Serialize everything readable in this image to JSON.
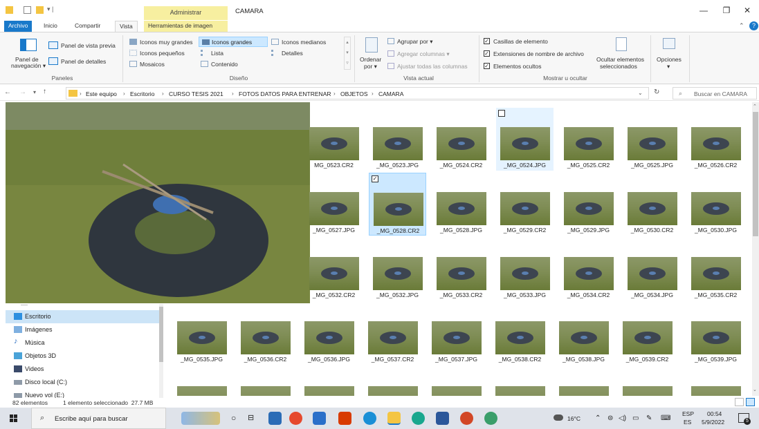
{
  "titlebar": {
    "context_tab_group": "Administrar",
    "window_title": "CAMARA",
    "minimize": "—",
    "maximize": "❐",
    "close": "✕"
  },
  "ribbon_tabs": {
    "file": "Archivo",
    "home": "Inicio",
    "share": "Compartir",
    "view": "Vista",
    "image_tools": "Herramientas de imagen"
  },
  "ribbon": {
    "panes": {
      "nav_pane": "Panel de",
      "nav_pane2": "navegación ▾",
      "preview_pane": "Panel de vista previa",
      "details_pane": "Panel de detalles",
      "group": "Paneles"
    },
    "layout": {
      "extra_large": "Iconos muy grandes",
      "large": "Iconos grandes",
      "medium": "Iconos medianos",
      "small": "Iconos pequeños",
      "list": "Lista",
      "details": "Detalles",
      "tiles": "Mosaicos",
      "content": "Contenido",
      "group": "Diseño"
    },
    "current_view": {
      "sort_by": "Ordenar",
      "sort_by2": "por ▾",
      "group_by": "Agrupar por ▾",
      "add_columns": "Agregar columnas ▾",
      "size_all_columns": "Ajustar todas las columnas",
      "group": "Vista actual"
    },
    "show_hide": {
      "item_checkboxes": "Casillas de elemento",
      "file_extensions": "Extensiones de nombre de archivo",
      "hidden_items": "Elementos ocultos",
      "hide_selected": "Ocultar elementos",
      "hide_selected2": "seleccionados",
      "group": "Mostrar u ocultar"
    },
    "options": "Opciones",
    "options_caret": "▾"
  },
  "address": {
    "path": [
      "Este equipo",
      "Escritorio",
      "CURSO TESIS 2021",
      "FOTOS DATOS PARA ENTRENAR",
      "OBJETOS",
      "CAMARA"
    ],
    "search_placeholder": "Buscar en CAMARA"
  },
  "nav_pane": {
    "items": [
      {
        "label": "Escritorio",
        "icon": "desktop-folder-icon"
      },
      {
        "label": "Imágenes",
        "icon": "pictures-folder-icon"
      },
      {
        "label": "Música",
        "icon": "music-folder-icon"
      },
      {
        "label": "Objetos 3D",
        "icon": "3d-objects-folder-icon"
      },
      {
        "label": "Videos",
        "icon": "videos-folder-icon"
      },
      {
        "label": "Disco local (C:)",
        "icon": "local-disk-icon"
      },
      {
        "label": "Nuevo vol (E:)",
        "icon": "drive-icon"
      }
    ]
  },
  "files": [
    "MG_0523.CR2",
    "_MG_0523.JPG",
    "_MG_0524.CR2",
    "_MG_0524.JPG",
    "_MG_0525.CR2",
    "_MG_0525.JPG",
    "_MG_0526.CR2",
    "_MG_0527.JPG",
    "_MG_0528.CR2",
    "_MG_0528.JPG",
    "_MG_0529.CR2",
    "_MG_0529.JPG",
    "_MG_0530.CR2",
    "_MG_0530.JPG",
    "_MG_0532.CR2",
    "_MG_0532.JPG",
    "_MG_0533.CR2",
    "_MG_0533.JPG",
    "_MG_0534.CR2",
    "_MG_0534.JPG",
    "_MG_0535.CR2",
    "_MG_0535.JPG",
    "_MG_0536.CR2",
    "_MG_0536.JPG",
    "_MG_0537.CR2",
    "_MG_0537.JPG",
    "_MG_0538.CR2",
    "_MG_0538.JPG",
    "_MG_0539.CR2",
    "_MG_0539.JPG"
  ],
  "selected_file": "_MG_0528.CR2",
  "status": {
    "count": "82 elementos",
    "selection": "1 elemento seleccionado  27.7 MB"
  },
  "taskbar": {
    "search_placeholder": "Escribe aquí para buscar",
    "weather": "16°C",
    "lang1": "ESP",
    "lang2": "ES",
    "time": "00:54",
    "date": "5/9/2022",
    "notifications": "5"
  },
  "colors": {
    "accent": "#1979ca",
    "context_tab": "#f7efa0",
    "selection": "#cce8ff"
  }
}
